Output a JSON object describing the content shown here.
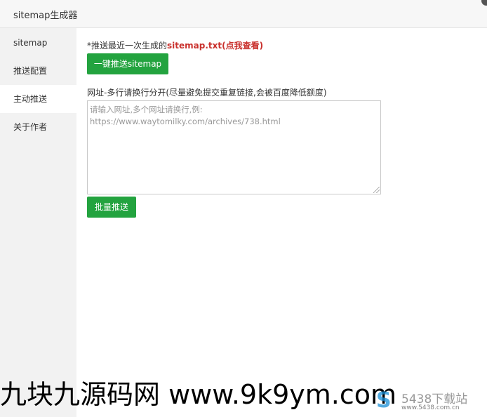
{
  "window": {
    "title": "sitemap生成器"
  },
  "sidebar": {
    "items": [
      {
        "label": "sitemap"
      },
      {
        "label": "推送配置"
      },
      {
        "label": "主动推送"
      },
      {
        "label": "关于作者"
      }
    ],
    "active_index": 2
  },
  "main": {
    "notice_prefix": "*推送最近一次生成的",
    "notice_link": "sitemap.txt(点我查看)",
    "onekey_button": "一键推送sitemap",
    "field_label": "网址-多行请换行分开(尽量避免提交重复链接,会被百度降低额度)",
    "textarea_placeholder": "请输入网址,多个网址请换行,例:\nhttps://www.waytomilky.com/archives/738.html",
    "batch_button": "批量推送"
  },
  "watermark": {
    "text": "九块九源码网 www.9k9ym.com",
    "logo_brand": "5438下载站",
    "logo_url": "www.5438.com.cn"
  },
  "colors": {
    "accent_green": "#23a33f",
    "link_red": "#c9302c"
  }
}
